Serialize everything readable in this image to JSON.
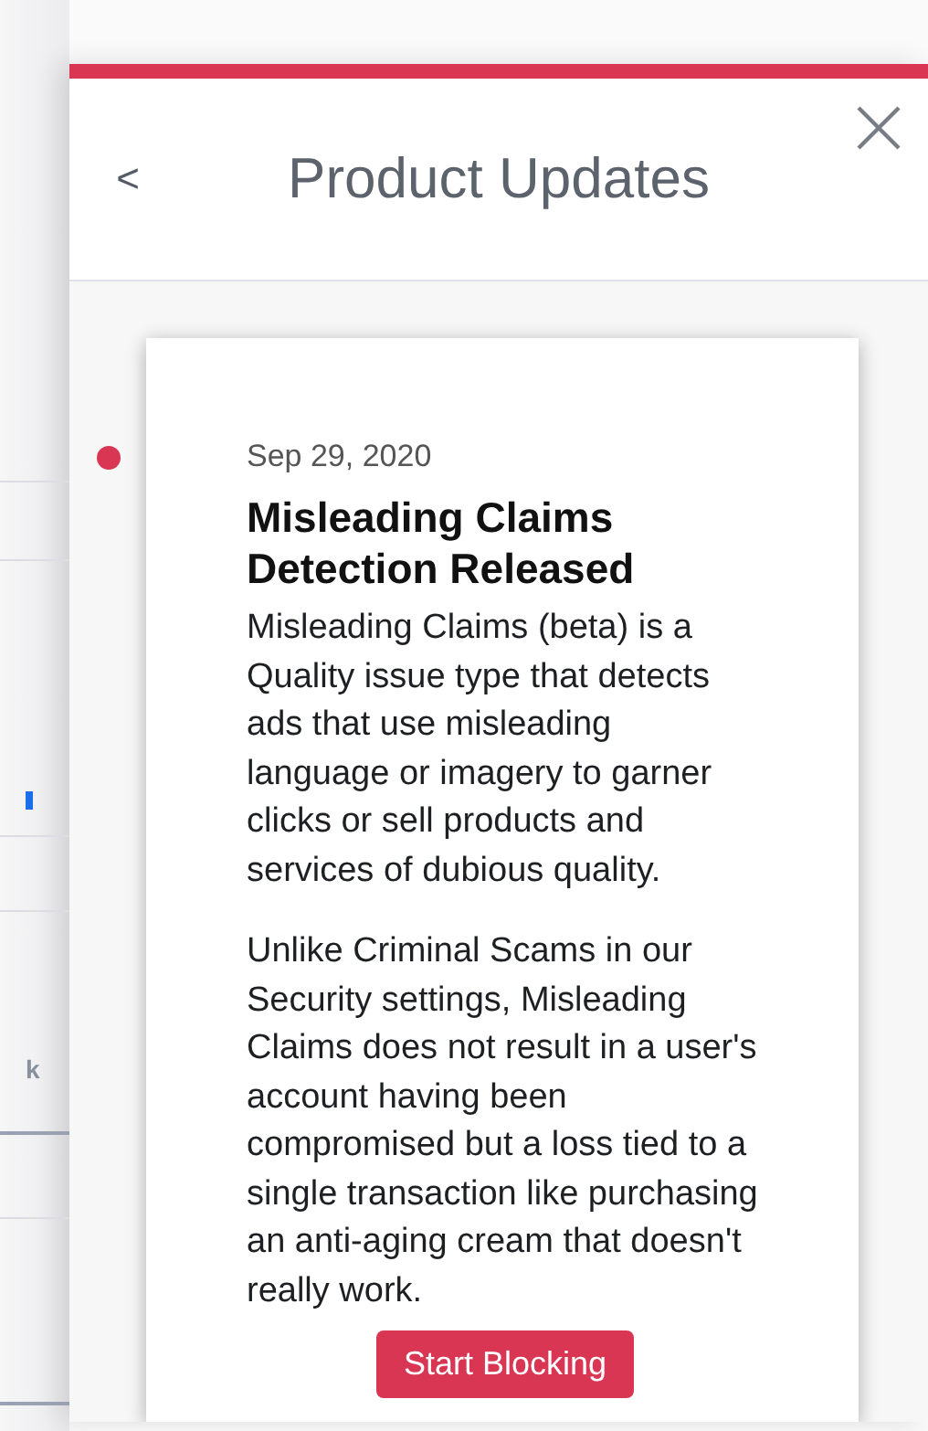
{
  "background": {
    "fragment": "k"
  },
  "panel": {
    "back": "<",
    "title": "Product Updates"
  },
  "updates": [
    {
      "unread": true,
      "date": "Sep 29, 2020",
      "title": "Misleading Claims Detection Released",
      "paragraphs": [
        "Misleading Claims (beta) is a Quality issue type that detects ads that use misleading language or imagery to garner clicks or sell products and services of dubious quality.",
        "Unlike Criminal Scams in our Security settings, Misleading Claims does not result in a user's account having been compromised but a loss tied to a single transaction like purchasing an anti-aging cream that doesn't really work."
      ],
      "button": "Start Blocking"
    }
  ]
}
